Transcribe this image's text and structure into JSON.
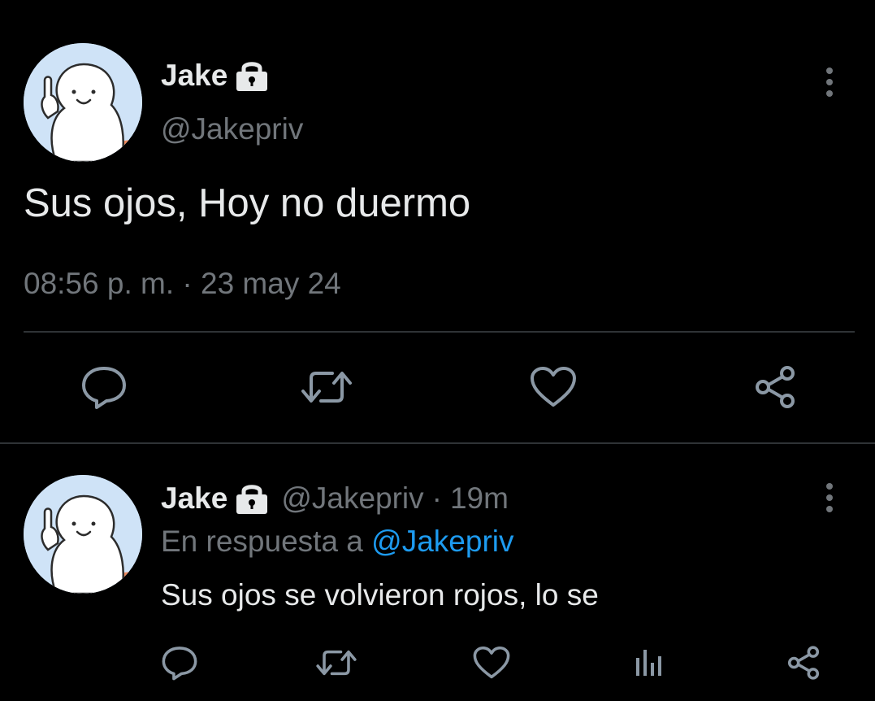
{
  "main_tweet": {
    "display_name": "Jake",
    "handle": "@Jakepriv",
    "text": "Sus ojos, Hoy no duermo",
    "timestamp": "08:56 p. m. · 23 may 24",
    "icons": {
      "lock": "lock-icon",
      "more": "more-vertical-icon",
      "reply": "reply-icon",
      "retweet": "retweet-icon",
      "like": "heart-icon",
      "share": "share-icon"
    }
  },
  "reply_tweet": {
    "display_name": "Jake",
    "handle": "@Jakepriv",
    "separator": "·",
    "time_ago": "19m",
    "reply_prefix": "En respuesta a",
    "reply_mention": "@Jakepriv",
    "text": "Sus ojos se volvieron rojos, lo se",
    "icons": {
      "lock": "lock-icon",
      "more": "more-vertical-icon",
      "reply": "reply-icon",
      "retweet": "retweet-icon",
      "like": "heart-icon",
      "views": "views-chart-icon",
      "share": "share-icon"
    }
  },
  "colors": {
    "background": "#000000",
    "primary_text": "#e7e9ea",
    "secondary_text": "#71767b",
    "link": "#1d9bf0",
    "divider": "#2f3336"
  }
}
